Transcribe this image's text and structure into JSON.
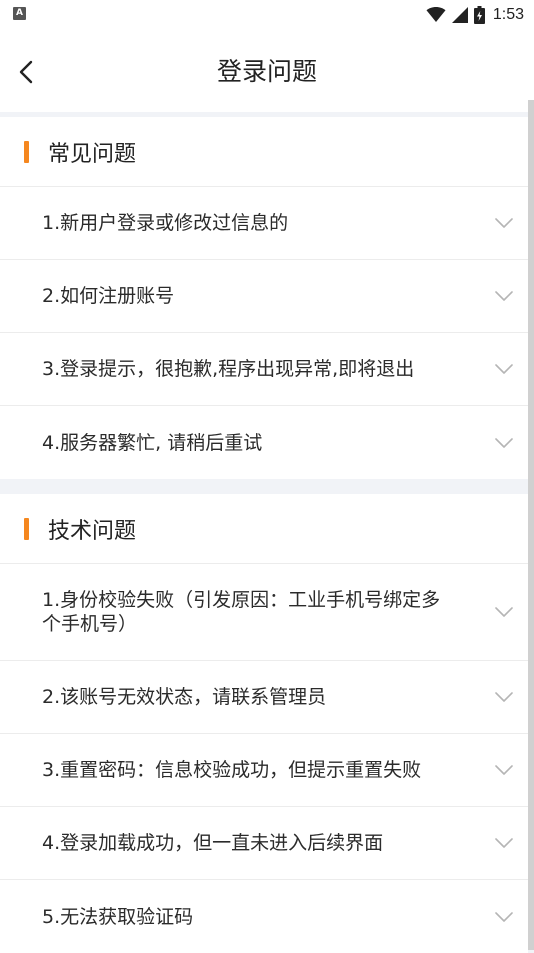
{
  "status": {
    "notification_badge": "A",
    "time": "1:53"
  },
  "header": {
    "title": "登录问题"
  },
  "sections": [
    {
      "title": "常见问题",
      "items": [
        "1.新用户登录或修改过信息的",
        "2.如何注册账号",
        "3.登录提示，很抱歉,程序出现异常,即将退出",
        "4.服务器繁忙, 请稍后重试"
      ]
    },
    {
      "title": "技术问题",
      "items": [
        "1.身份校验失败（引发原因：工业手机号绑定多个手机号）",
        "2.该账号无效状态，请联系管理员",
        "3.重置密码：信息校验成功，但提示重置失败",
        "4.登录加载成功，但一直未进入后续界面",
        "5.无法获取验证码"
      ]
    }
  ],
  "colors": {
    "accent": "#f5871f",
    "background": "#f1f3f7",
    "divider": "#ececec"
  },
  "icons": {
    "back": "chevron-left-icon",
    "expand": "chevron-down-icon",
    "wifi": "wifi-icon",
    "signal": "signal-icon",
    "battery": "battery-icon"
  }
}
